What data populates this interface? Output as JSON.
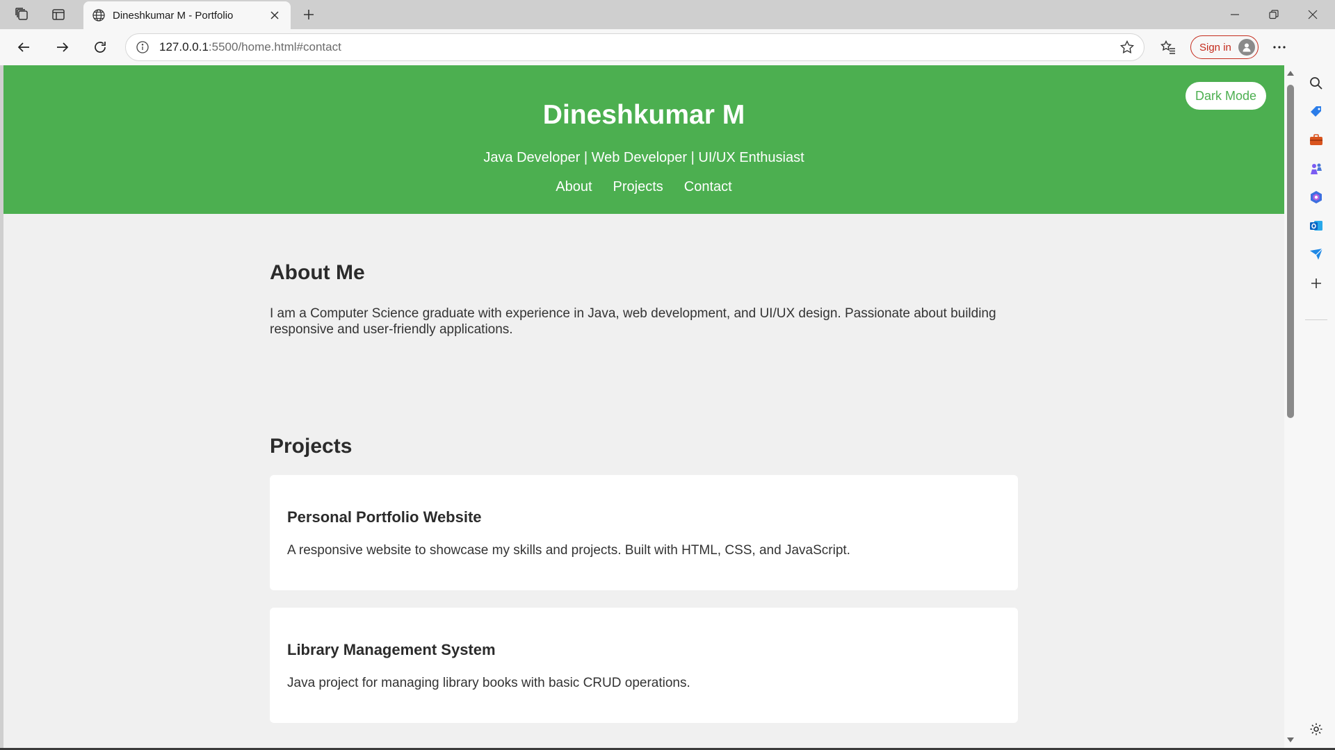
{
  "browser": {
    "tab": {
      "title": "Dineshkumar M - Portfolio"
    },
    "address": {
      "host": "127.0.0.1",
      "rest": ":5500/home.html#contact"
    },
    "signin_label": "Sign in"
  },
  "page": {
    "header": {
      "name": "Dineshkumar M",
      "tagline": "Java Developer | Web Developer | UI/UX Enthusiast",
      "nav": [
        "About",
        "Projects",
        "Contact"
      ],
      "dark_mode_label": "Dark Mode"
    },
    "about": {
      "title": "About Me",
      "text": "I am a Computer Science graduate with experience in Java, web development, and UI/UX design. Passionate about building responsive and user-friendly applications."
    },
    "projects": {
      "title": "Projects",
      "items": [
        {
          "title": "Personal Portfolio Website",
          "desc": "A responsive website to showcase my skills and projects. Built with HTML, CSS, and JavaScript."
        },
        {
          "title": "Library Management System",
          "desc": "Java project for managing library books with basic CRUD operations."
        }
      ]
    }
  },
  "colors": {
    "header_green": "#4caf50",
    "page_bg": "#f0f0f0",
    "signin_red": "#c42b1c"
  },
  "icons": {
    "tab_bar": [
      "workspaces-icon",
      "tab-actions-icon",
      "globe-icon",
      "close-icon",
      "plus-icon"
    ],
    "window": [
      "minimize-icon",
      "restore-icon",
      "close-icon"
    ],
    "toolbar": [
      "back-icon",
      "forward-icon",
      "refresh-icon",
      "info-icon",
      "star-icon",
      "favorites-icon",
      "more-icon",
      "copilot-icon"
    ],
    "sidebar": [
      "search-icon",
      "shopping-tag-icon",
      "tools-icon",
      "games-icon",
      "m365-icon",
      "outlook-icon",
      "send-icon",
      "add-icon",
      "settings-icon"
    ]
  }
}
